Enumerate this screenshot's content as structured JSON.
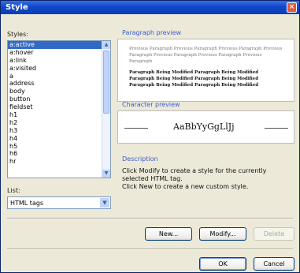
{
  "window": {
    "title": "Style",
    "close_symbol": "×"
  },
  "styles_label": "Styles:",
  "styles": [
    "a:active",
    "a:hover",
    "a:link",
    "a:visited",
    "a",
    "address",
    "body",
    "button",
    "fieldset",
    "h1",
    "h2",
    "h3",
    "h4",
    "h5",
    "h6",
    "hr"
  ],
  "selected_style": "a:active",
  "list_label": "List:",
  "list_select_value": "HTML tags",
  "paragraph_preview_label": "Paragraph preview",
  "paragraph_preview": {
    "previous": "Previous Paragraph Previous Paragraph Previous Paragraph Previous Paragraph Previous Paragraph Previous Paragraph Previous Paragraph",
    "modified": "Paragraph Being Modified Paragraph Being Modified Paragraph Being Modified Paragraph Being Modified Paragraph Being Modified Paragraph Being Modified"
  },
  "character_preview_label": "Character preview",
  "character_sample": "AaBbYyGgLlJj",
  "description_label": "Description",
  "description_lines": [
    "Click Modify to create a style for the currently",
    "selected HTML tag.",
    "Click New to create a new custom style."
  ],
  "buttons": {
    "new": "New...",
    "modify": "Modify...",
    "delete": "Delete",
    "ok": "OK",
    "cancel": "Cancel"
  },
  "colors": {
    "title_bar": "#1048c8",
    "selection": "#316ac5",
    "section_label": "#3a5cd0",
    "dialog_bg": "#ece9d8"
  }
}
